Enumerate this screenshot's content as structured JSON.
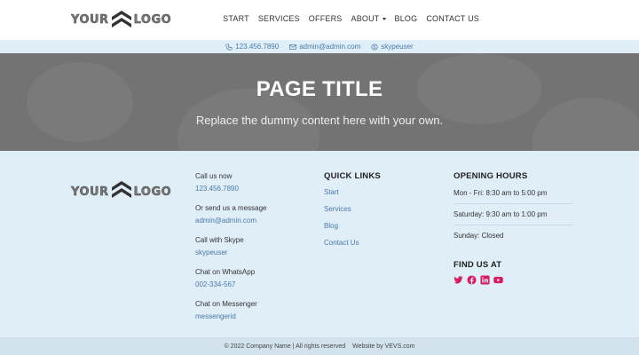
{
  "header": {
    "logo": {
      "left": "YOUR",
      "right": "LOGO"
    },
    "nav": [
      {
        "label": "START"
      },
      {
        "label": "SERVICES"
      },
      {
        "label": "OFFERS"
      },
      {
        "label": "ABOUT"
      },
      {
        "label": "BLOG"
      },
      {
        "label": "CONTACT US"
      }
    ]
  },
  "contact_bar": {
    "phone": "123.456.7890",
    "email": "admin@admin.com",
    "skype": "skypeuser"
  },
  "hero": {
    "title": "PAGE TITLE",
    "subtitle": "Replace the dummy content here with your own."
  },
  "footer": {
    "logo": {
      "left": "YOUR",
      "right": "LOGO"
    },
    "contacts": [
      {
        "label": "Call us now",
        "value": "123.456.7890"
      },
      {
        "label": "Or send us a message",
        "value": "admin@admin.com"
      },
      {
        "label": "Call with Skype",
        "value": "skypeuser"
      },
      {
        "label": "Chat on WhatsApp",
        "value": "002-334-567"
      },
      {
        "label": "Chat on Messenger",
        "value": "messengerid"
      }
    ],
    "quick_links": {
      "heading": "QUICK LINKS",
      "items": [
        "Start",
        "Services",
        "Blog",
        "Contact Us"
      ]
    },
    "opening_hours": {
      "heading": "OPENING HOURS",
      "items": [
        "Mon - Fri: 8:30 am to 5:00 pm",
        "Saturday: 9:30 am to 1:00 pm",
        "Sunday: Closed"
      ]
    },
    "find_us": {
      "heading": "FIND US AT",
      "icons": [
        "twitter-icon",
        "facebook-icon",
        "linkedin-icon",
        "youtube-icon"
      ],
      "color": "#d81b60"
    }
  },
  "bottom_bar": {
    "copyright": "© 2022 Company Name | All rights reserved",
    "credit": "Website by VEVS.com"
  }
}
